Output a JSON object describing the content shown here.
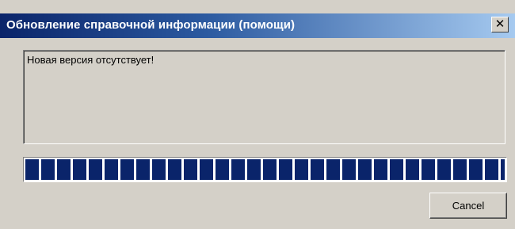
{
  "window": {
    "title": "Обновление справочной информации (помощи)",
    "close_glyph": "✕"
  },
  "message": {
    "text": "Новая версия отсутствует!"
  },
  "progress": {
    "percent": 100,
    "color": "#0a246a"
  },
  "buttons": {
    "cancel_label": "Cancel"
  },
  "icons": {
    "close": "close-icon"
  }
}
